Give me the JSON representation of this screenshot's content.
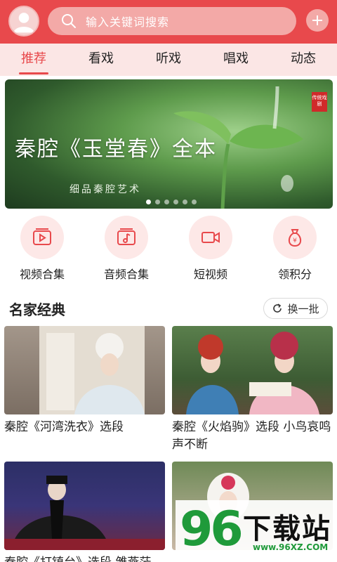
{
  "header": {
    "search_placeholder": "输入关键词搜索",
    "accent": "#e8494c"
  },
  "tabs": [
    {
      "label": "推荐",
      "active": true
    },
    {
      "label": "看戏",
      "active": false
    },
    {
      "label": "听戏",
      "active": false
    },
    {
      "label": "唱戏",
      "active": false
    },
    {
      "label": "动态",
      "active": false
    }
  ],
  "banner": {
    "title": "秦腔《玉堂春》全本",
    "subtitle": "细品秦腔艺术",
    "badge": "传统戏剧",
    "slide_count": 6,
    "current_slide": 1
  },
  "quick_actions": [
    {
      "label": "视频合集",
      "icon": "video-collection-icon"
    },
    {
      "label": "音频合集",
      "icon": "audio-collection-icon"
    },
    {
      "label": "短视频",
      "icon": "short-video-icon"
    },
    {
      "label": "领积分",
      "icon": "points-bag-icon"
    }
  ],
  "section": {
    "title": "名家经典",
    "refresh_label": "换一批"
  },
  "cards": [
    {
      "title": "秦腔《河湾洗衣》选段"
    },
    {
      "title": "秦腔《火焰驹》选段 小鸟哀鸣声不断"
    },
    {
      "title": "秦腔《打镇台》选段 雏燕茫"
    },
    {
      "title": ""
    }
  ],
  "watermark": {
    "number": "96",
    "text": "下载站",
    "url": "www.96XZ.COM"
  }
}
